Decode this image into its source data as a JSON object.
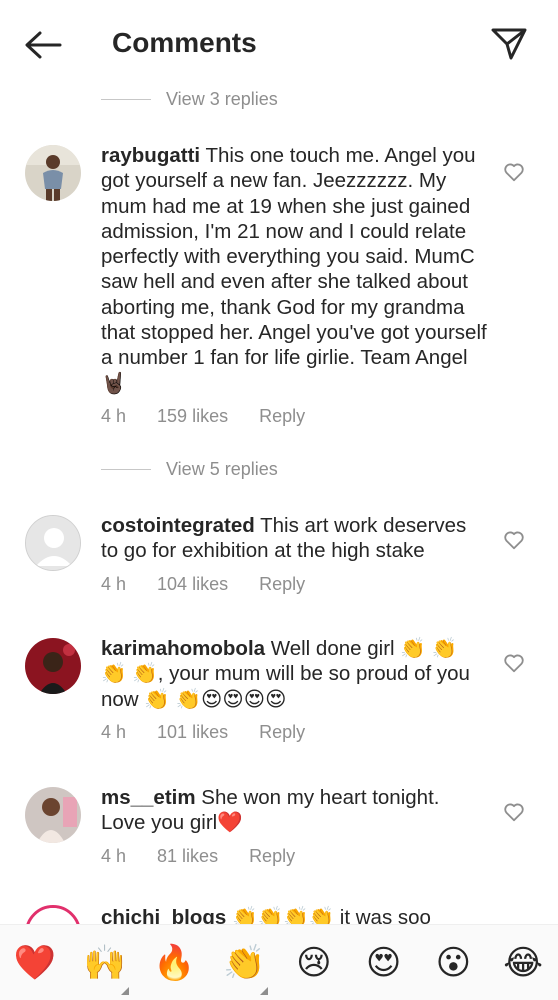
{
  "header": {
    "title": "Comments"
  },
  "threads": {
    "view_replies_1": "View 3 replies",
    "view_replies_2": "View 5 replies"
  },
  "comments": [
    {
      "username": "raybugatti",
      "text": "This one touch me. Angel you got yourself a new fan. Jeezzzzzz. My mum had me at 19 when she just gained admission, I'm 21 now and I could relate perfectly with everything you said. MumC saw hell and even after she talked about aborting me, thank God for my grandma that stopped her. Angel you've got yourself a number 1 fan for life girlie. Team Angel 🤘🏿",
      "time": "4 h",
      "likes": "159 likes",
      "reply": "Reply"
    },
    {
      "username": "costointegrated",
      "text": "This art work deserves to go for exhibition at the high stake",
      "time": "4 h",
      "likes": "104 likes",
      "reply": "Reply"
    },
    {
      "username": "karimahomobola",
      "text": "Well done girl 👏 👏 👏 👏, your mum will be so proud of you now 👏 👏😍😍😍😍",
      "time": "4 h",
      "likes": "101 likes",
      "reply": "Reply"
    },
    {
      "username": "ms__etim",
      "text": "She won my heart tonight. Love you girl❤️",
      "time": "4 h",
      "likes": "81 likes",
      "reply": "Reply"
    },
    {
      "username": "chichi_blogs",
      "text": "👏👏👏👏 it was soo"
    }
  ],
  "emoji_bar": [
    "❤️",
    "🙌",
    "🔥",
    "👏",
    "😢",
    "😍",
    "😮",
    "😂"
  ],
  "icons": {
    "back": "back-arrow-icon",
    "send": "send-icon",
    "like": "heart-outline-icon"
  },
  "colors": {
    "text": "#262626",
    "secondary": "#8e8e8e",
    "divider": "#c7c7c7"
  }
}
